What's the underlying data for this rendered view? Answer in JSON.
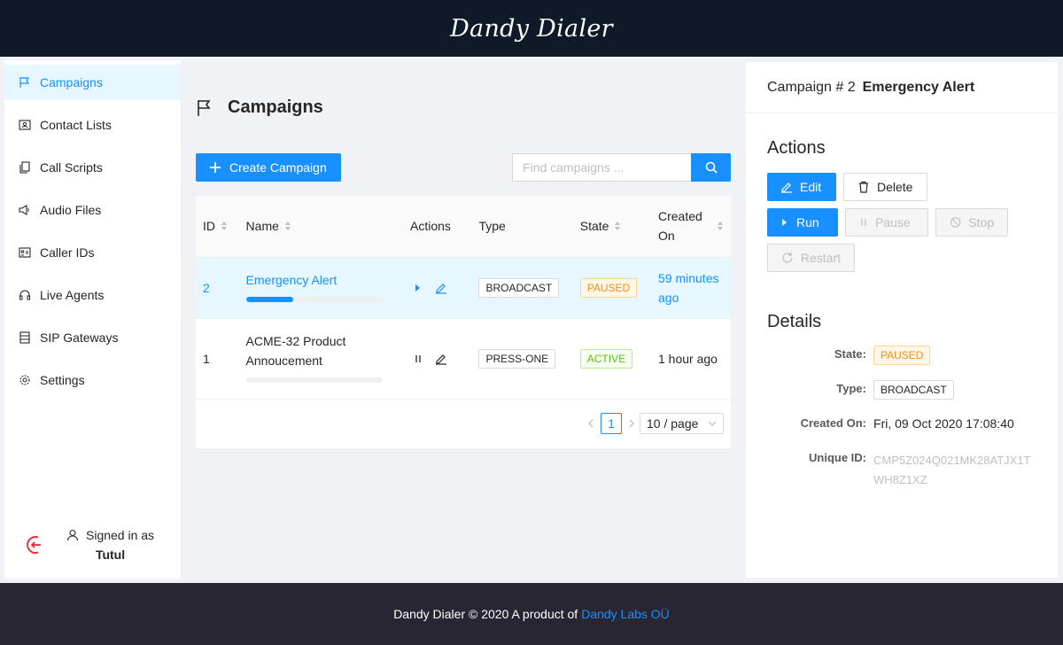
{
  "app": {
    "brand": "Dandy Dialer"
  },
  "sidebar": {
    "items": [
      {
        "label": "Campaigns",
        "icon": "flag-icon",
        "active": true
      },
      {
        "label": "Contact Lists",
        "icon": "contacts-icon"
      },
      {
        "label": "Call Scripts",
        "icon": "copy-icon"
      },
      {
        "label": "Audio Files",
        "icon": "sound-icon"
      },
      {
        "label": "Caller IDs",
        "icon": "idcard-icon"
      },
      {
        "label": "Live Agents",
        "icon": "headset-icon"
      },
      {
        "label": "SIP Gateways",
        "icon": "database-icon"
      },
      {
        "label": "Settings",
        "icon": "gear-icon"
      }
    ],
    "signed_in_label": "Signed in as",
    "user": "Tutul"
  },
  "main": {
    "title": "Campaigns",
    "create_button": "Create Campaign",
    "search_placeholder": "Find campaigns ...",
    "table": {
      "columns": [
        "ID",
        "Name",
        "Actions",
        "Type",
        "State",
        "Created On"
      ],
      "rows": [
        {
          "id": "2",
          "name": "Emergency Alert",
          "progress": 0.35,
          "type": "BROADCAST",
          "state": "PAUSED",
          "created": "59 minutes ago",
          "action": "play"
        },
        {
          "id": "1",
          "name": "ACME-32 Product Annoucement",
          "progress": 0,
          "type": "PRESS-ONE",
          "state": "ACTIVE",
          "created": "1 hour ago",
          "action": "pause"
        }
      ]
    },
    "pagination": {
      "current": "1",
      "page_size": "10 / page"
    }
  },
  "detail": {
    "campaign_prefix": "Campaign # 2",
    "campaign_name": "Emergency Alert",
    "actions_title": "Actions",
    "buttons": {
      "edit": "Edit",
      "delete": "Delete",
      "run": "Run",
      "pause": "Pause",
      "stop": "Stop",
      "restart": "Restart"
    },
    "details_title": "Details",
    "fields": {
      "state_label": "State:",
      "state": "PAUSED",
      "type_label": "Type:",
      "type": "BROADCAST",
      "created_label": "Created On:",
      "created": "Fri, 09 Oct 2020 17:08:40",
      "uid_label": "Unique ID:",
      "uid_line1": "CMP5Z024Q021MK28ATJX1T",
      "uid_line2": "WH8Z1XZ"
    }
  },
  "footer": {
    "text": "Dandy Dialer © 2020 A product of",
    "link": "Dandy Labs OÜ"
  },
  "colors": {
    "primary": "#1890ff",
    "topbar": "#0f1927",
    "footer": "#282633",
    "paused": "#fa8c16",
    "active": "#52c41a"
  }
}
